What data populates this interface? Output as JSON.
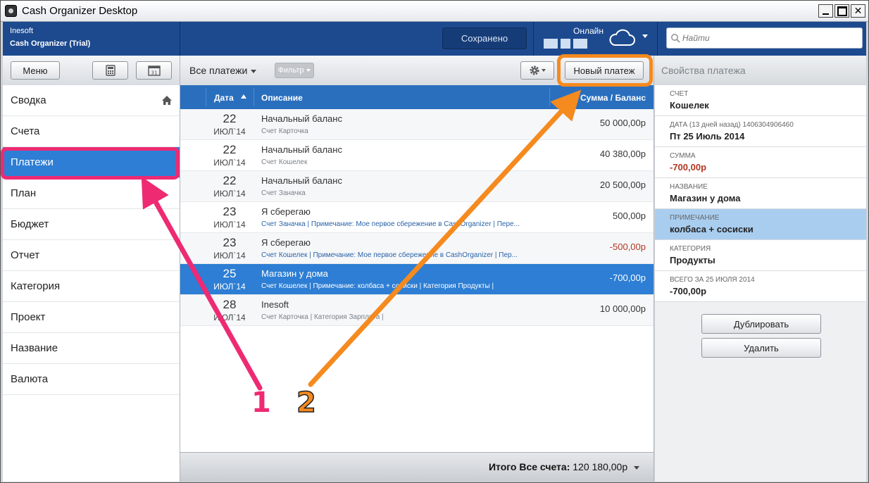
{
  "window": {
    "title": "Cash Organizer Desktop"
  },
  "brand": {
    "company": "Inesoft",
    "product": "Cash Organizer (Trial)"
  },
  "topbar": {
    "saved_label": "Сохранено",
    "online_label": "Онлайн",
    "search_placeholder": "Найти"
  },
  "toolbar": {
    "menu_label": "Меню",
    "all_payments_label": "Все платежи",
    "filter_label": "Фильтр",
    "new_payment_label": "Новый платеж",
    "properties_title": "Свойства платежа"
  },
  "sidebar": {
    "items": [
      {
        "label": "Сводка"
      },
      {
        "label": "Счета"
      },
      {
        "label": "Платежи",
        "active": true
      },
      {
        "label": "План"
      },
      {
        "label": "Бюджет"
      },
      {
        "label": "Отчет"
      },
      {
        "label": "Категория"
      },
      {
        "label": "Проект"
      },
      {
        "label": "Название"
      },
      {
        "label": "Валюта"
      }
    ]
  },
  "list": {
    "headers": {
      "date": "Дата",
      "description": "Описание",
      "amount": "Сумма / Баланс"
    },
    "rows": [
      {
        "day": "22",
        "month": "ИЮЛ`14",
        "desc": "Начальный баланс",
        "sub": "Счет Карточка",
        "amount": "50 000,00р"
      },
      {
        "day": "22",
        "month": "ИЮЛ`14",
        "desc": "Начальный баланс",
        "sub": "Счет Кошелек",
        "amount": "40 380,00р"
      },
      {
        "day": "22",
        "month": "ИЮЛ`14",
        "desc": "Начальный баланс",
        "sub": "Счет Заначка",
        "amount": "20 500,00р"
      },
      {
        "day": "23",
        "month": "ИЮЛ`14",
        "desc": "Я сберегаю",
        "sub": "Счет Заначка | Примечание: Мое первое сбережение в CashOrganizer | Пере...",
        "amount": "500,00р"
      },
      {
        "day": "23",
        "month": "ИЮЛ`14",
        "desc": "Я сберегаю",
        "sub": "Счет Кошелек | Примечание: Мое первое сбережение в CashOrganizer | Пер...",
        "amount": "-500,00р"
      },
      {
        "day": "25",
        "month": "ИЮЛ`14",
        "desc": "Магазин у дома",
        "sub": "Счет Кошелек | Примечание: колбаса + сосиски | Категория Продукты |",
        "amount": "-700,00р"
      },
      {
        "day": "28",
        "month": "ИЮЛ`14",
        "desc": "Inesoft",
        "sub": "Счет Карточка | Категория Зарплата |",
        "amount": "10 000,00р"
      }
    ],
    "total_label": "Итого Все счета:",
    "total_value": "120 180,00р"
  },
  "properties": {
    "fields": [
      {
        "label": "СЧЕТ",
        "value": "Кошелек"
      },
      {
        "label": "ДАТА (13 дней назад) 1406304906460",
        "value": "Пт 25 Июль 2014"
      },
      {
        "label": "СУММА",
        "value": "-700,00р"
      },
      {
        "label": "НАЗВАНИЕ",
        "value": "Магазин у дома"
      },
      {
        "label": "ПРИМЕЧАНИЕ",
        "value": "колбаса + сосиски"
      },
      {
        "label": "КАТЕГОРИЯ",
        "value": "Продукты"
      },
      {
        "label": "ВСЕГО ЗА 25 ИЮЛЯ 2014",
        "value": "-700,00р"
      }
    ],
    "duplicate_label": "Дублировать",
    "delete_label": "Удалить"
  },
  "annotations": {
    "one": "1",
    "two": "2"
  },
  "colors": {
    "accent": "#2d7ed4",
    "topbar": "#1d4a8f",
    "negative": "#b1361e",
    "callout_pink": "#ee2a73",
    "callout_orange": "#f58a1f"
  }
}
